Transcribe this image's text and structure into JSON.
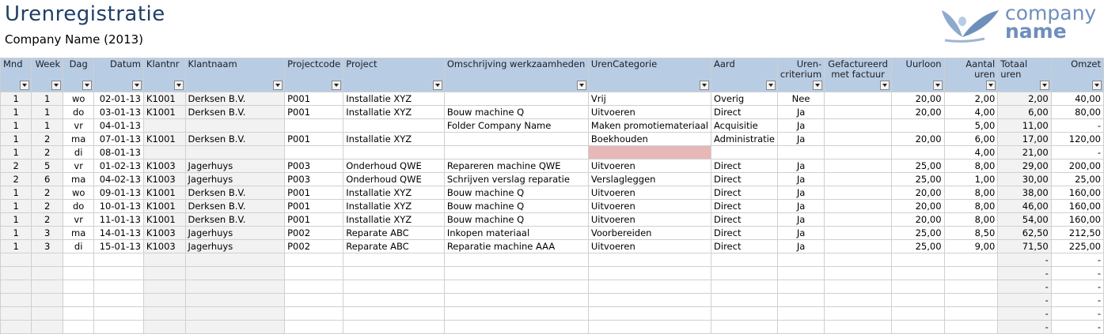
{
  "title": "Urenregistratie",
  "subtitle": "Company Name (2013)",
  "logo": {
    "line1": "company",
    "line2": "name"
  },
  "colors": {
    "header_bg": "#b8cce4",
    "title": "#1f3f66",
    "highlight": "#e6b8b7",
    "logo": "#6f8fbb"
  },
  "columns": [
    "Mnd",
    "Week",
    "Dag",
    "Datum",
    "Klantnr",
    "Klantnaam",
    "Projectcode",
    "Project",
    "Omschrijving werkzaamheden",
    "UrenCategorie",
    "Aard",
    "Uren-criterium",
    "Gefactureerd met factuur",
    "Uurloon",
    "Aantal uren",
    "Totaal uren",
    "Omzet"
  ],
  "rows": [
    [
      "1",
      "1",
      "wo",
      "02-01-13",
      "K1001",
      "Derksen B.V.",
      "P001",
      "Installatie XYZ",
      "",
      "Vrij",
      "Overig",
      "Nee",
      "",
      "20,00",
      "2,00",
      "2,00",
      "40,00"
    ],
    [
      "1",
      "1",
      "do",
      "03-01-13",
      "K1001",
      "Derksen B.V.",
      "P001",
      "Installatie XYZ",
      "Bouw machine Q",
      "Uitvoeren",
      "Direct",
      "Ja",
      "",
      "20,00",
      "4,00",
      "6,00",
      "80,00"
    ],
    [
      "1",
      "1",
      "vr",
      "04-01-13",
      "",
      "",
      "",
      "",
      "Folder Company Name",
      "Maken promotiemateriaal",
      "Acquisitie",
      "Ja",
      "",
      "",
      "5,00",
      "11,00",
      "-"
    ],
    [
      "1",
      "2",
      "ma",
      "07-01-13",
      "K1001",
      "Derksen B.V.",
      "P001",
      "Installatie XYZ",
      "",
      "Boekhouden",
      "Administratie",
      "Ja",
      "",
      "20,00",
      "6,00",
      "17,00",
      "120,00"
    ],
    [
      "1",
      "2",
      "di",
      "08-01-13",
      "",
      "",
      "",
      "",
      "",
      "",
      "",
      "",
      "",
      "",
      "4,00",
      "21,00",
      "-"
    ],
    [
      "2",
      "5",
      "vr",
      "01-02-13",
      "K1003",
      "Jagerhuys",
      "P003",
      "Onderhoud QWE",
      "Repareren machine QWE",
      "Uitvoeren",
      "Direct",
      "Ja",
      "",
      "25,00",
      "8,00",
      "29,00",
      "200,00"
    ],
    [
      "2",
      "6",
      "ma",
      "04-02-13",
      "K1003",
      "Jagerhuys",
      "P003",
      "Onderhoud QWE",
      "Schrijven verslag reparatie",
      "Verslagleggen",
      "Direct",
      "Ja",
      "",
      "25,00",
      "1,00",
      "30,00",
      "25,00"
    ],
    [
      "1",
      "2",
      "wo",
      "09-01-13",
      "K1001",
      "Derksen B.V.",
      "P001",
      "Installatie XYZ",
      "Bouw machine Q",
      "Uitvoeren",
      "Direct",
      "Ja",
      "",
      "20,00",
      "8,00",
      "38,00",
      "160,00"
    ],
    [
      "1",
      "2",
      "do",
      "10-01-13",
      "K1001",
      "Derksen B.V.",
      "P001",
      "Installatie XYZ",
      "Bouw machine Q",
      "Uitvoeren",
      "Direct",
      "Ja",
      "",
      "20,00",
      "8,00",
      "46,00",
      "160,00"
    ],
    [
      "1",
      "2",
      "vr",
      "11-01-13",
      "K1001",
      "Derksen B.V.",
      "P001",
      "Installatie XYZ",
      "Bouw machine Q",
      "Uitvoeren",
      "Direct",
      "Ja",
      "",
      "20,00",
      "8,00",
      "54,00",
      "160,00"
    ],
    [
      "1",
      "3",
      "ma",
      "14-01-13",
      "K1003",
      "Jagerhuys",
      "P002",
      "Reparate ABC",
      "Inkopen materiaal",
      "Voorbereiden",
      "Direct",
      "Ja",
      "",
      "25,00",
      "8,50",
      "62,50",
      "212,50"
    ],
    [
      "1",
      "3",
      "di",
      "15-01-13",
      "K1003",
      "Jagerhuys",
      "P002",
      "Reparate ABC",
      "Reparatie machine AAA",
      "Uitvoeren",
      "Direct",
      "Ja",
      "",
      "25,00",
      "9,00",
      "71,50",
      "225,00"
    ],
    [
      "",
      "",
      "",
      "",
      "",
      "",
      "",
      "",
      "",
      "",
      "",
      "",
      "",
      "",
      "",
      "-",
      "-"
    ],
    [
      "",
      "",
      "",
      "",
      "",
      "",
      "",
      "",
      "",
      "",
      "",
      "",
      "",
      "",
      "",
      "-",
      "-"
    ],
    [
      "",
      "",
      "",
      "",
      "",
      "",
      "",
      "",
      "",
      "",
      "",
      "",
      "",
      "",
      "",
      "-",
      "-"
    ],
    [
      "",
      "",
      "",
      "",
      "",
      "",
      "",
      "",
      "",
      "",
      "",
      "",
      "",
      "",
      "",
      "-",
      "-"
    ],
    [
      "",
      "",
      "",
      "",
      "",
      "",
      "",
      "",
      "",
      "",
      "",
      "",
      "",
      "",
      "",
      "-",
      "-"
    ],
    [
      "",
      "",
      "",
      "",
      "",
      "",
      "",
      "",
      "",
      "",
      "",
      "",
      "",
      "",
      "",
      "-",
      "-"
    ]
  ]
}
